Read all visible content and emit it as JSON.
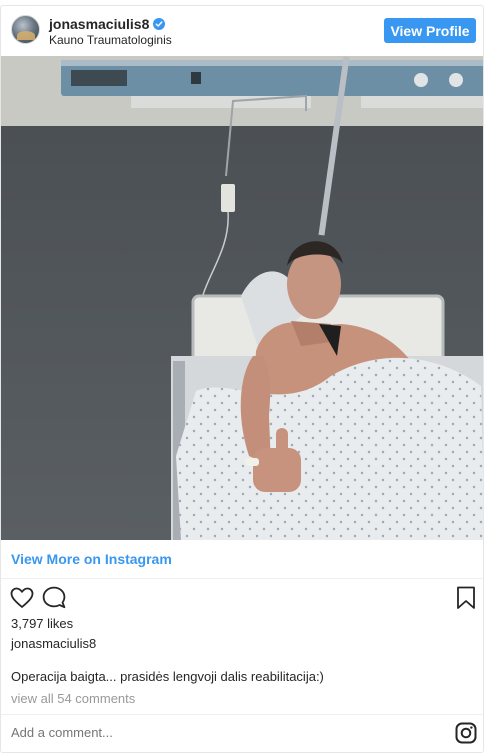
{
  "header": {
    "username": "jonasmaciulis8",
    "location": "Kauno Traumatologinis",
    "view_profile_label": "View Profile"
  },
  "post": {
    "view_more_label": "View More on Instagram",
    "likes": "3,797 likes",
    "author": "jonasmaciulis8",
    "caption": "Operacija baigta... prasidės lengvoji dalis reabilitacija:)",
    "view_comments": "view all 54 comments",
    "add_comment_placeholder": "Add a comment..."
  },
  "icons": {
    "verified": "verified-badge-icon",
    "like": "heart-outline-icon",
    "comment": "comment-bubble-icon",
    "save": "bookmark-outline-icon",
    "instagram": "instagram-logo-icon"
  },
  "colors": {
    "accent": "#3897f0",
    "text": "#262626",
    "muted": "#999999",
    "border": "#e6e6e6"
  }
}
